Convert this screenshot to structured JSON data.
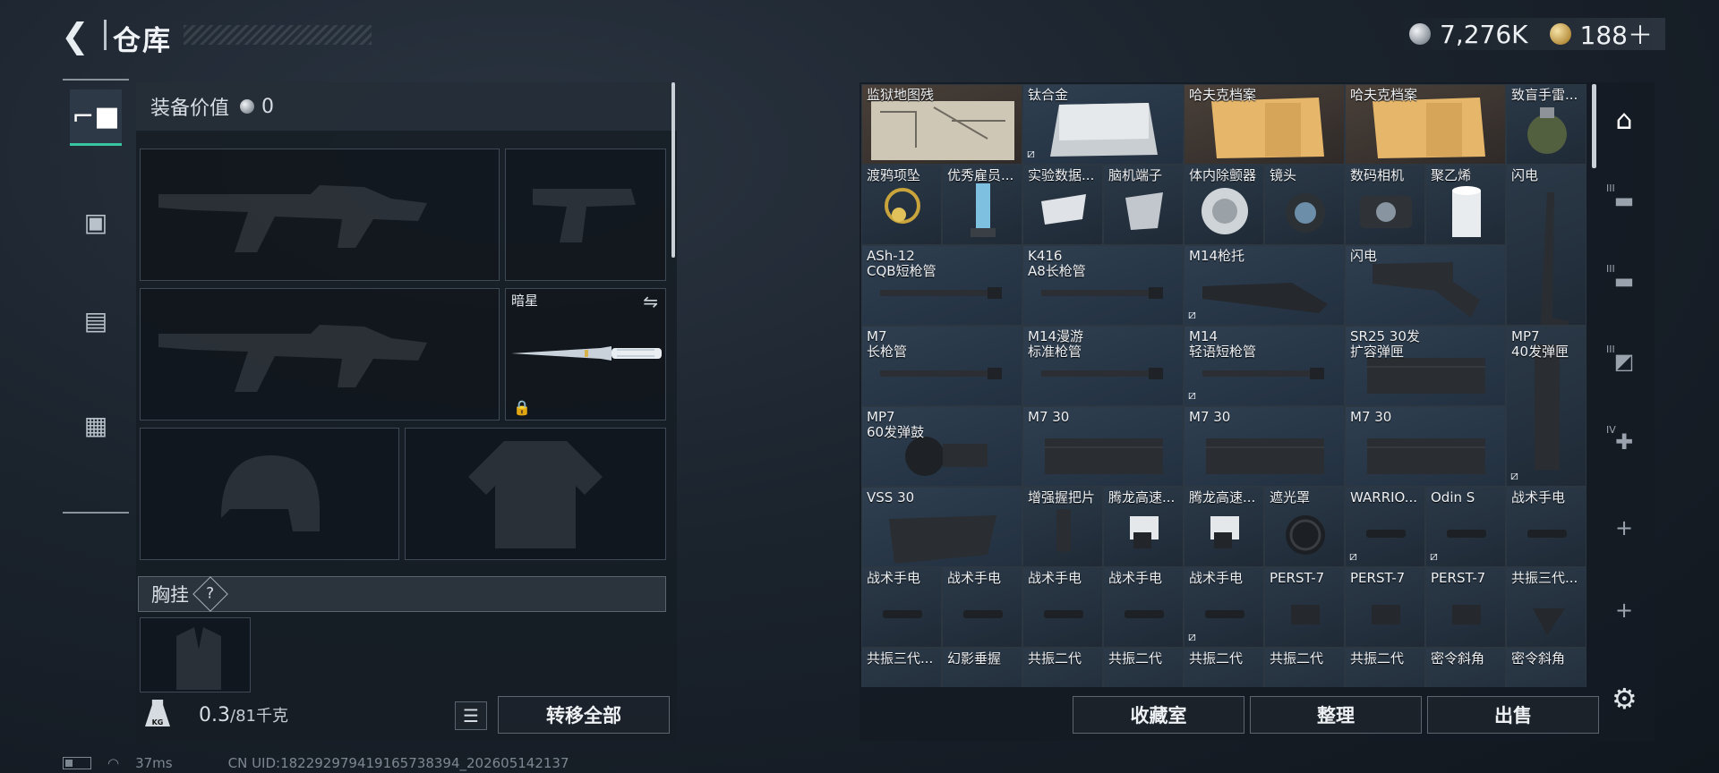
{
  "header": {
    "title": "仓库",
    "currency_silver": "7,276K",
    "currency_gold": "188＋"
  },
  "left_tabs": [
    {
      "icon": "pistol-icon",
      "glyph": "🔫"
    },
    {
      "icon": "backpack-icon",
      "glyph": "🎒"
    },
    {
      "icon": "vest-icon",
      "glyph": "🦺"
    },
    {
      "icon": "toolbox-icon",
      "glyph": "🧰"
    }
  ],
  "equipment": {
    "value_label": "装备价值",
    "value": "0",
    "melee_name": "暗星",
    "chest_rig_label": "胸挂",
    "help": "?"
  },
  "weight": {
    "current": "0.3",
    "max": "/81千克",
    "icon_text": "KG"
  },
  "buttons": {
    "transfer_all": "转移全部",
    "collection": "收藏室",
    "organize": "整理",
    "sell": "出售"
  },
  "status": {
    "ping": "37ms",
    "uid": "CN UID:1822929794191657383​94_202605142137"
  },
  "storage": {
    "items": [
      {
        "name": "监狱地图残",
        "kind": "map"
      },
      {
        "name": "钛合金",
        "kind": "metal"
      },
      {
        "name": "哈夫克档案",
        "kind": "folder"
      },
      {
        "name": "哈夫克档案",
        "kind": "folder"
      },
      {
        "name": "致盲手雷...",
        "kind": "grenade"
      },
      {
        "name": "渡鸦项坠",
        "kind": "pendant"
      },
      {
        "name": "优秀雇员...",
        "kind": "trophy"
      },
      {
        "name": "实验数据...",
        "kind": "whistle"
      },
      {
        "name": "脑机端子",
        "kind": "device"
      },
      {
        "name": "体内除颤器",
        "kind": "disc"
      },
      {
        "name": "镜头",
        "kind": "lens"
      },
      {
        "name": "数码相机",
        "kind": "camera"
      },
      {
        "name": "聚乙烯",
        "kind": "roll"
      },
      {
        "name": "闪电",
        "kind": "stock"
      },
      {
        "name": "ASh-12\nCQB短枪管",
        "kind": "barrel"
      },
      {
        "name": "K416\nA8长枪管",
        "kind": "barrel"
      },
      {
        "name": "M14枪托",
        "kind": "buttstock"
      },
      {
        "name": "闪电",
        "kind": "stock2"
      },
      {
        "name": "M7\n长枪管",
        "kind": "barrel"
      },
      {
        "name": "M14漫游\n标准枪管",
        "kind": "barrel"
      },
      {
        "name": "M14\n轻语短枪管",
        "kind": "barrel"
      },
      {
        "name": "SR25 30发\n扩容弹匣",
        "kind": "mag-box"
      },
      {
        "name": "MP7\n40发弹匣",
        "kind": "mag-tall"
      },
      {
        "name": "MP7\n60发弹鼓",
        "kind": "drum"
      },
      {
        "name": "M7 30",
        "kind": "mag-box"
      },
      {
        "name": "M7 30",
        "kind": "mag-box"
      },
      {
        "name": "M7 30",
        "kind": "mag-box"
      },
      {
        "name": "VSS 30",
        "kind": "mag-curve"
      },
      {
        "name": "增强握把片",
        "kind": "grip"
      },
      {
        "name": "腾龙高速...",
        "kind": "mount"
      },
      {
        "name": "腾龙高速...",
        "kind": "mount"
      },
      {
        "name": "遮光罩",
        "kind": "hood"
      },
      {
        "name": "WARRIO...",
        "kind": "light"
      },
      {
        "name": "Odin S",
        "kind": "light"
      },
      {
        "name": "战术手电",
        "kind": "light"
      },
      {
        "name": "战术手电",
        "kind": "light"
      },
      {
        "name": "战术手电",
        "kind": "light"
      },
      {
        "name": "战术手电",
        "kind": "light"
      },
      {
        "name": "战术手电",
        "kind": "light"
      },
      {
        "name": "战术手电",
        "kind": "light"
      },
      {
        "name": "PERST-7",
        "kind": "laser"
      },
      {
        "name": "PERST-7",
        "kind": "laser"
      },
      {
        "name": "PERST-7",
        "kind": "laser"
      },
      {
        "name": "共振三代...",
        "kind": "grip2"
      },
      {
        "name": "共振三代...",
        "kind": "light"
      },
      {
        "name": "幻影垂握",
        "kind": "light"
      },
      {
        "name": "共振二代",
        "kind": "light"
      },
      {
        "name": "共振二代",
        "kind": "light"
      },
      {
        "name": "共振二代",
        "kind": "light"
      },
      {
        "name": "共振二代",
        "kind": "light"
      },
      {
        "name": "共振二代",
        "kind": "light"
      },
      {
        "name": "密令斜角",
        "kind": "light"
      },
      {
        "name": "密令斜角",
        "kind": "light"
      }
    ]
  },
  "categories": [
    {
      "icon": "all-items-icon",
      "glyph": "⌂",
      "num": ""
    },
    {
      "icon": "weapon-tier3-icon",
      "glyph": "▬",
      "num": "III"
    },
    {
      "icon": "weapon-tier3b-icon",
      "glyph": "▬",
      "num": "III"
    },
    {
      "icon": "attachment-tier3-icon",
      "glyph": "◩",
      "num": "III"
    },
    {
      "icon": "medical-tier4-icon",
      "glyph": "✚",
      "num": "IV"
    },
    {
      "icon": "add-icon",
      "glyph": "+",
      "num": ""
    },
    {
      "icon": "add-icon",
      "glyph": "+",
      "num": ""
    }
  ]
}
